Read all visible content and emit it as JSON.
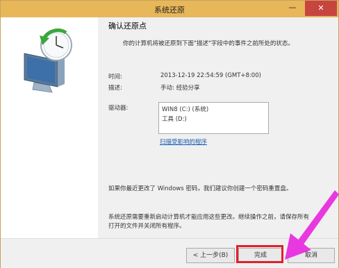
{
  "window": {
    "title": "系统还原",
    "minimize_glyph": "—",
    "close_glyph": "✕"
  },
  "content": {
    "heading": "确认还原点",
    "description": "你的计算机将被还原到下面\"描述\"字段中的事件之前所处的状态。",
    "time_label": "时间:",
    "time_value": "2013-12-19 22:54:59 (GMT+8:00)",
    "desc_label": "描述:",
    "desc_value": "手动: 经验分享",
    "drives_label": "驱动器:",
    "drives": [
      "WIN8 (C:) (系统)",
      "工具 (D:)"
    ],
    "scan_link": "扫描受影响的程序",
    "password_note": "如果你最近更改了 Windows 密码，我们建议你创建一个密码重置盘。",
    "restart_note_line1": "系统还原需要重新启动计算机才能应用这些更改。继续操作之前，请保存所有",
    "restart_note_line2": "打开的文件并关闭所有程序。"
  },
  "buttons": {
    "back": "< 上一步(B)",
    "finish": "完成",
    "cancel": "取消"
  },
  "icons": {
    "restore": "system-restore-icon",
    "arrow": "pointer-arrow-annotation"
  },
  "colors": {
    "titlebar": "#e8b75a",
    "close": "#c7453f",
    "highlight": "#e0202d",
    "arrow": "#e838e0"
  }
}
